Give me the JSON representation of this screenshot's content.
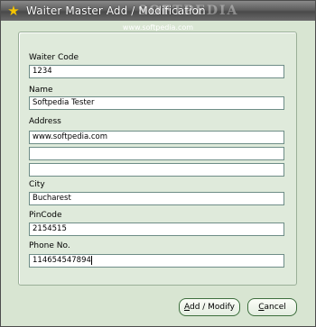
{
  "window": {
    "title": "Waiter Master Add / Modification",
    "watermark_logo": "SOFTPEDIA",
    "watermark_url": "www.softpedia.com",
    "icon": "star-icon"
  },
  "form": {
    "waiter_code": {
      "label": "Waiter Code",
      "value": "1234"
    },
    "name": {
      "label": "Name",
      "value": "Softpedia Tester"
    },
    "address": {
      "label": "Address",
      "lines": [
        "www.softpedia.com",
        "",
        ""
      ]
    },
    "city": {
      "label": "City",
      "value": "Bucharest"
    },
    "pincode": {
      "label": "PinCode",
      "value": "2154515"
    },
    "phone": {
      "label": "Phone No.",
      "value": "114654547894"
    }
  },
  "buttons": {
    "add_modify": {
      "label_mnemonic": "A",
      "label_rest": "dd / Modify"
    },
    "cancel": {
      "label_mnemonic": "C",
      "label_rest": "ancel"
    }
  }
}
